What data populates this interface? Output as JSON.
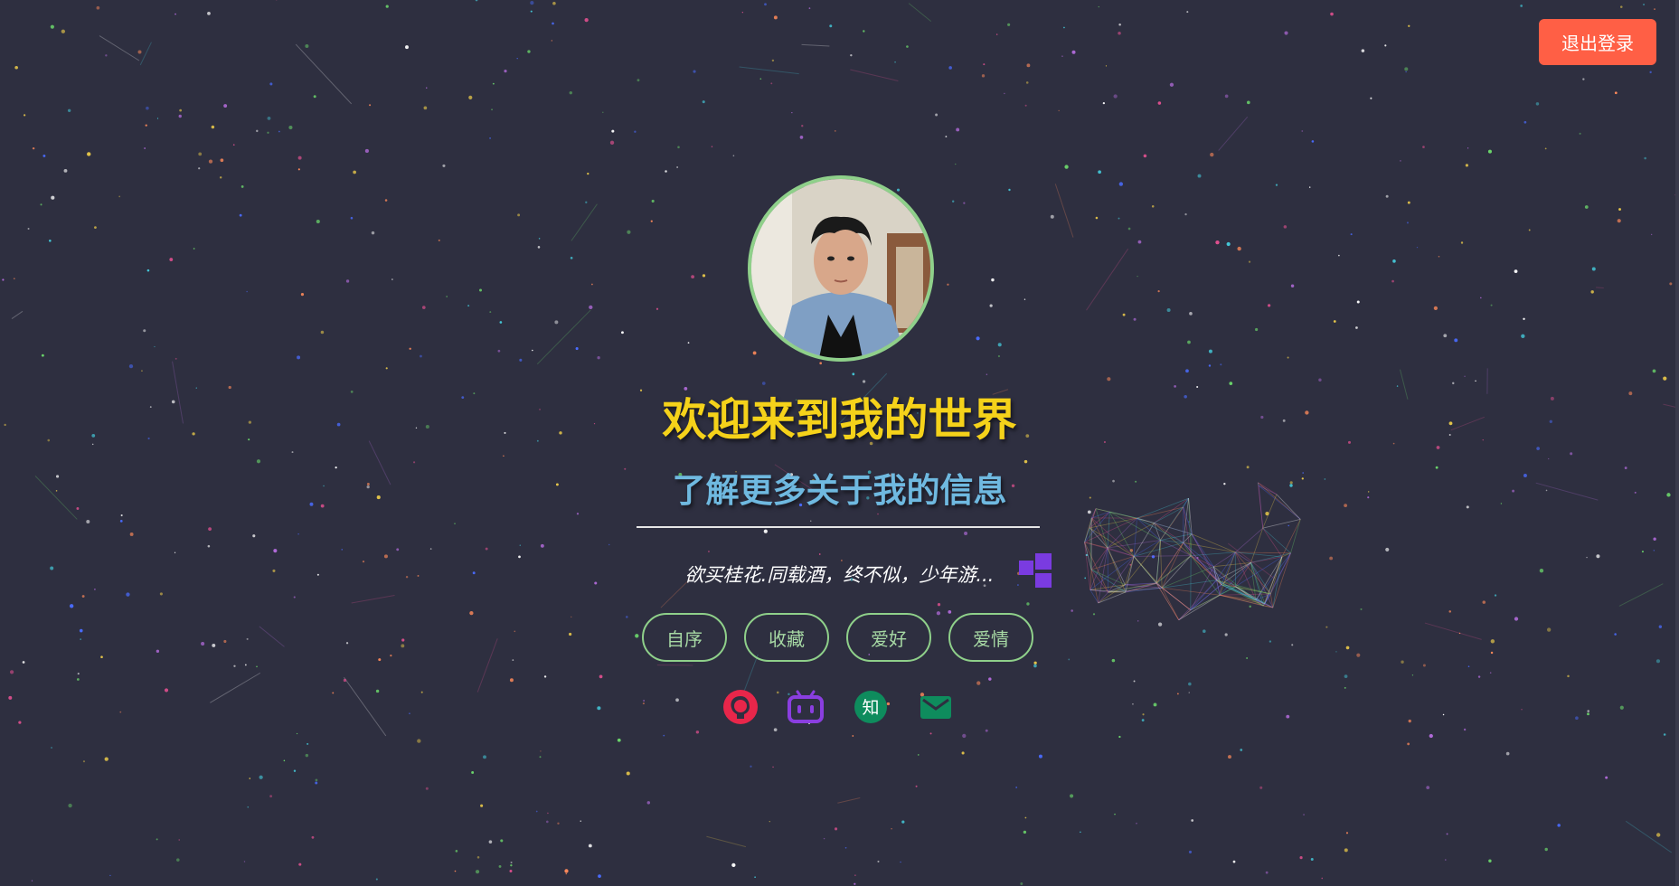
{
  "header": {
    "logout_label": "退出登录"
  },
  "hero": {
    "title": "欢迎来到我的世界",
    "subtitle": "了解更多关于我的信息",
    "motto": "欲买桂花.同载酒，终不似，少年游..."
  },
  "tags": [
    {
      "label": "自序"
    },
    {
      "label": "收藏"
    },
    {
      "label": "爱好"
    },
    {
      "label": "爱情"
    }
  ],
  "socials": [
    {
      "icon": "github-icon",
      "color": "#e8264a"
    },
    {
      "icon": "bilibili-icon",
      "color": "#8a3ee0"
    },
    {
      "icon": "zhihu-icon",
      "color": "#0e8c5d",
      "text": "知"
    },
    {
      "icon": "email-icon",
      "color": "#0e8c5d"
    }
  ],
  "colors": {
    "background": "#2e2f40",
    "accent_title": "#f5d21a",
    "accent_subtitle": "#6fb9e0",
    "tag_border": "#8fd08a",
    "logout_button": "#ff5f45"
  }
}
